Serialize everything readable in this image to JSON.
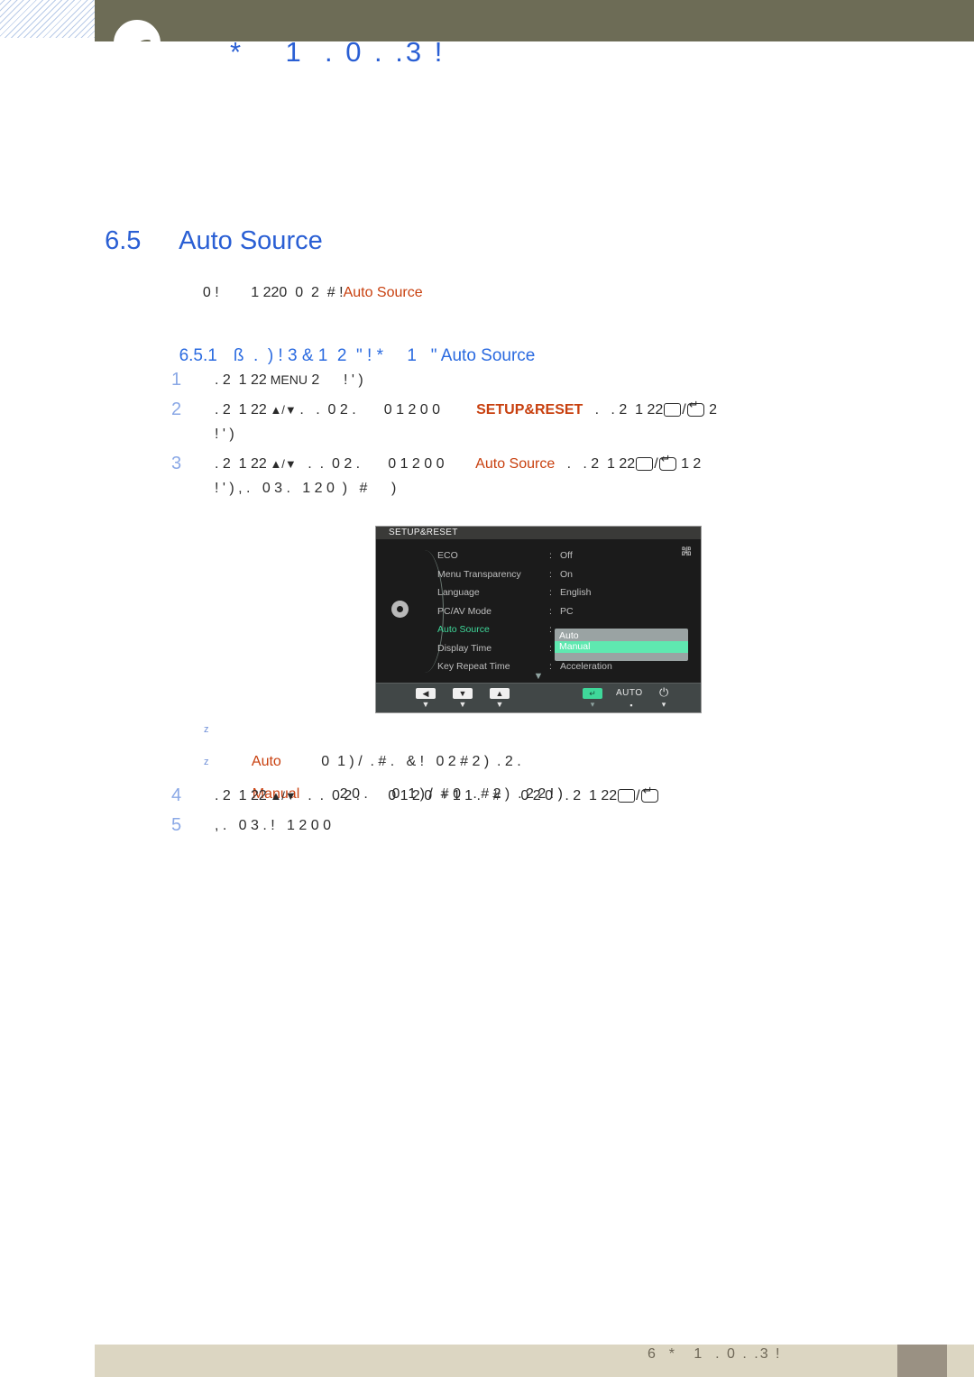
{
  "page": {
    "header_title": "*    1  . 0 . .3 !",
    "footer_text": "6  *   1  . 0 . .3 !"
  },
  "section": {
    "number": "6.5",
    "title": "Auto Source",
    "intro_prefix": "0 !        1 ",
    "intro_mid": "2",
    "intro_mid2": "20  0  2  # !",
    "intro_highlight": "Auto Source"
  },
  "subsection": {
    "number": "6.5.1",
    "text": "ß  .  ) ! 3 & 1  2  \" ! *     1   \" ",
    "highlight": "Auto Source"
  },
  "steps": [
    {
      "num": "1",
      "pre": ". 2  1 2",
      "bold2": "2",
      "kbd": " MENU",
      "post": " 2      ! ' )"
    },
    {
      "num": "2",
      "seg1": ". 2  1 2",
      "seg1b": "2",
      "arrows": " ▲/▼ ",
      "seg2": ".   .  0 2 .       0 1 2 0 0         ",
      "hl": "SETUP&RESET",
      "seg3": "   .   . 2  1 2",
      "seg3b": "2",
      "seg4": " 2\n! ' )"
    },
    {
      "num": "3",
      "seg1": ". 2  1 2",
      "seg1b": "2",
      "arrows": " ▲/▼ ",
      "seg2": "  .  .  0 2 .       0 1 2 0 0        ",
      "hl": "Auto Source",
      "seg3": "   .   . 2  1 2",
      "seg3b": "2",
      "seg4": " 1 2\n! ' ) , .   0 3 .   1 2 0  )   #      )"
    }
  ],
  "bullets": [
    {
      "marker": "z",
      "name": "Auto",
      "desc": "          0  1 ) /  . # .   & !   0 2 # 2 )  . 2 ."
    },
    {
      "marker": "z",
      "name": "Manual",
      "desc": "          2 0 .      0  1 ) /  # 0   . # 2 )  . 2 2 ! )"
    }
  ],
  "steps2": [
    {
      "num": "4",
      "seg1": ". 2  1 2",
      "seg1b": "2",
      "arrows": " ▲/▼ ",
      "seg2": "  .  .  0 2 .       0 1 2 0  + 1 1 .   #     0 2 0   . 2  1 2",
      "seg2b": "2",
      "seg3": " "
    },
    {
      "num": "5",
      "seg1": ", .   0 3 . !   1 2 0 0",
      "seg1b": "",
      "arrows": "",
      "seg2": "",
      "seg2b": "",
      "seg3": ""
    }
  ],
  "osd": {
    "title": "SETUP&RESET",
    "corner_icon": "嘂",
    "gear_icon": "gear",
    "rows": [
      {
        "label": "ECO",
        "colon": ":",
        "value": "Off",
        "active": false
      },
      {
        "label": "Menu Transparency",
        "colon": ":",
        "value": "On",
        "active": false
      },
      {
        "label": "Language",
        "colon": ":",
        "value": "English",
        "active": false
      },
      {
        "label": "PC/AV Mode",
        "colon": ":",
        "value": "PC",
        "active": false
      },
      {
        "label": "Auto Source",
        "colon": ":",
        "value": "",
        "active": true
      },
      {
        "label": "Display Time",
        "colon": ":",
        "value": "",
        "active": false
      },
      {
        "label": "Key Repeat Time",
        "colon": ":",
        "value": "Acceleration",
        "active": false
      }
    ],
    "dropdown": {
      "options": [
        "Auto",
        "Manual"
      ],
      "selected": "Manual",
      "selected_color": "#5fe8b0"
    },
    "scroll_chevron": "▼",
    "buttons": [
      {
        "glyph": "◀",
        "tick": "▼",
        "kind": "white"
      },
      {
        "glyph": "▼",
        "tick": "▼",
        "kind": "white"
      },
      {
        "glyph": "▲",
        "tick": "▼",
        "kind": "white"
      },
      {
        "glyph": "↵",
        "tick": "▾",
        "kind": "green"
      }
    ],
    "auto_label": "AUTO",
    "auto_tick": "▪",
    "power_icon": "⏻",
    "power_tick": "▾"
  },
  "colors": {
    "header_band": "#6d6c56",
    "heading_blue": "#2a5fd4",
    "accent_orange": "#c8400f",
    "step_number_blue": "#8aa8e6",
    "footer_band": "#dcd6c2",
    "footer_block": "#9a9183"
  }
}
